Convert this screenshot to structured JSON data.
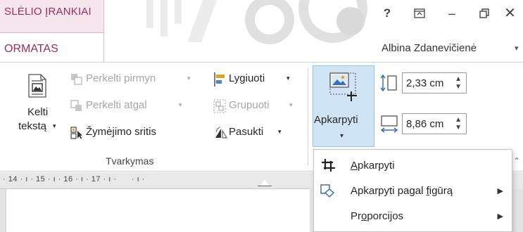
{
  "window": {
    "context_tab_title": "SLĖLIO ĮRANKIAI",
    "active_tab": "ORMATAS",
    "help": "?",
    "ribbon_display_icon": "ribbon-display-icon",
    "minimize": "–",
    "restore": "🗗",
    "close": "✕",
    "user_name": "Albina Zdanevičienė",
    "user_caret": "▾"
  },
  "ribbon": {
    "group_label": "Tvarkymas",
    "wrap_text": {
      "line1": "Kelti",
      "line2": "tekstą",
      "caret": "▾"
    },
    "bring_forward": {
      "label": "Perkelti pirmyn",
      "caret": "▾"
    },
    "send_backward": {
      "label": "Perkelti atgal",
      "caret": "▾"
    },
    "selection_pane": {
      "label": "Žymėjimo sritis"
    },
    "align": {
      "label": "Lygiuoti",
      "caret": "▾"
    },
    "group": {
      "label": "Grupuoti",
      "caret": "▾"
    },
    "rotate": {
      "label": "Pasukti",
      "caret": "▾"
    },
    "crop": {
      "label": "Apkarpyti",
      "caret": "▾"
    },
    "height": {
      "value": "2,33 cm"
    },
    "width": {
      "value": "8,86 cm"
    },
    "spin_arrows": "▲\n▼"
  },
  "ruler": {
    "text": "· 14 · ı · 15 · ı · 16 · ı · 17 · ı ·      · ı ·"
  },
  "menu": {
    "items": [
      {
        "label_u": "A",
        "label_rest": "pkarpyti",
        "has_submenu": false
      },
      {
        "label_pre": "Apkarpyti pagal ",
        "label_u": "f",
        "label_rest": "igūrą",
        "has_submenu": true
      },
      {
        "label_pre": "Pr",
        "label_u": "o",
        "label_rest": "porcijos",
        "has_submenu": true
      }
    ],
    "submenu_arrow": "▶",
    "corner_glyph": "⌃"
  },
  "colors": {
    "context_accent": "#9c2a5f",
    "crop_highlight": "#cfe4f7",
    "crop_border": "#98c4ea"
  }
}
